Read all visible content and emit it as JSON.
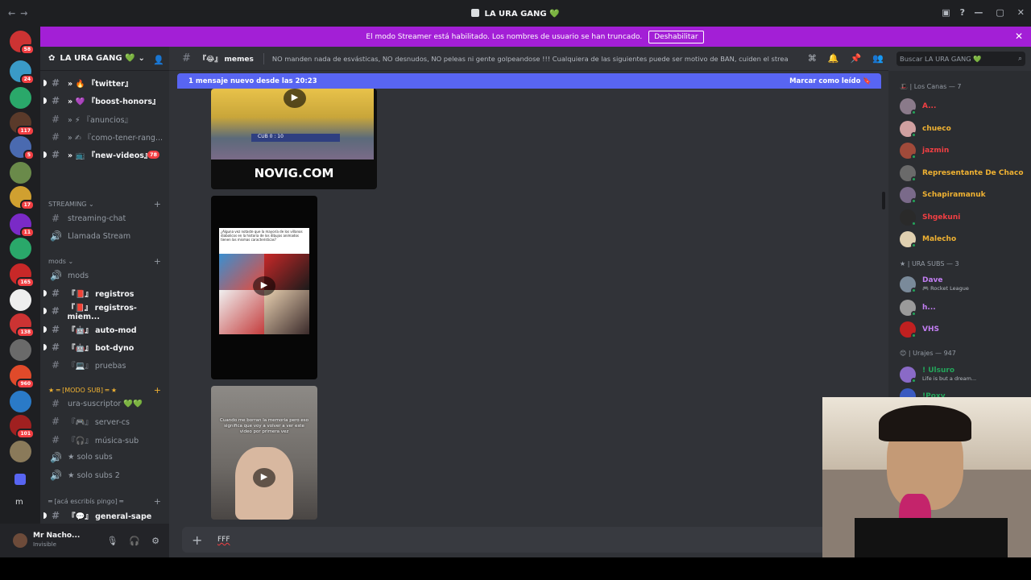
{
  "window": {
    "title": "LA URA GANG 💚"
  },
  "banner": {
    "text": "El modo Streamer está habilitado. Los nombres de usuario se han truncado.",
    "button": "Deshabilitar"
  },
  "servers": [
    {
      "badge": "58"
    },
    {
      "badge": "24"
    },
    {
      "badge": ""
    },
    {
      "badge": "117"
    },
    {
      "badge": "5"
    },
    {
      "badge": ""
    },
    {
      "badge": "17"
    },
    {
      "badge": "11"
    },
    {
      "badge": ""
    },
    {
      "badge": "165"
    },
    {
      "badge": ""
    },
    {
      "badge": "138"
    },
    {
      "badge": ""
    },
    {
      "badge": "960"
    },
    {
      "badge": ""
    },
    {
      "badge": "101"
    },
    {
      "badge": ""
    }
  ],
  "server": {
    "name": "LA URA GANG 💚"
  },
  "channels": [
    {
      "label": "» 🔥 『twitter』",
      "bold": true,
      "y": 0
    },
    {
      "label": "» 💜 『boost-honors』",
      "bold": true
    },
    {
      "label": "» ⚡ 『anuncios』",
      "bold": false
    },
    {
      "label": "» ✍ 『como-tener-rang...",
      "bold": false
    },
    {
      "label": "» 📺 『new-videos』",
      "bold": true,
      "badge": "78"
    }
  ],
  "categories": {
    "streaming": "STREAMING",
    "mods": "mods",
    "modo_sub": "═ [MODO SUB] ═ ★",
    "aca": "═ [acá escribís pingo] ═"
  },
  "streaming_channels": [
    {
      "label": "streaming-chat",
      "icon": "#"
    },
    {
      "label": "Llamada Stream",
      "icon": "🔊"
    }
  ],
  "mods_channels": [
    {
      "label": "mods",
      "icon": "🔊"
    },
    {
      "label": "『📕』 registros",
      "bold": true
    },
    {
      "label": "『📕』 registros-miem...",
      "bold": true
    },
    {
      "label": "『🤖』 auto-mod",
      "bold": true
    },
    {
      "label": "『🤖』 bot-dyno",
      "bold": true
    },
    {
      "label": "『💻』 pruebas",
      "bold": false
    }
  ],
  "sub_channels": [
    {
      "label": "ura-suscriptor 💚💚",
      "icon": "#"
    },
    {
      "label": "『🎮』 server-cs",
      "icon": "#"
    },
    {
      "label": "『🎧』 música-sub",
      "icon": "#"
    },
    {
      "label": "★ solo subs",
      "icon": "🔊"
    },
    {
      "label": "★ solo subs 2",
      "icon": "🔊"
    }
  ],
  "aca_channels": [
    {
      "label": "『💬』 general-sape",
      "bold": true
    },
    {
      "label": "『😂』 memes",
      "active": true
    }
  ],
  "user": {
    "name": "Mr Nacho...",
    "status": "Invisible"
  },
  "chat": {
    "channel": "『😂』 memes",
    "topic": "NO manden nada de esvásticas, NO desnudos, NO peleas ni gente golpeandose !!! Cualquiera de las siguientes puede ser motivo de BAN, cuiden el stream!",
    "new_messages": "1 mensaje nuevo desde las 20:23",
    "mark_read": "Marcar como leído",
    "input": "FFF"
  },
  "media": {
    "m1_text": "NOVIG.COM",
    "m1_score": "CUB 0 : 10",
    "m2_caption": "¿Alguna vez notaste que la mayoría de los villanos diabolicos en la historia de los dibujos animados tienen las mismas características?",
    "m3_caption": "Cuando me borran la memoria pero eso significa que voy a volver a ver este video por primera vez"
  },
  "members": {
    "search": "Buscar LA URA GANG 💚",
    "groups": [
      {
        "title": "🎩 | Los Canas — 7",
        "members": [
          {
            "name": "A...",
            "color": "#f23f43"
          },
          {
            "name": "chueco",
            "color": "#f0b232"
          },
          {
            "name": "jazmin",
            "color": "#f23f43"
          },
          {
            "name": "Representante De Chaco",
            "color": "#f0b232"
          },
          {
            "name": "Schapiramanuk",
            "color": "#f0b232"
          },
          {
            "name": "Shgekuni",
            "color": "#f23f43"
          },
          {
            "name": "Malecho",
            "color": "#f0b232"
          }
        ]
      },
      {
        "title": "★ | URA SUBS — 3",
        "members": [
          {
            "name": "Dave",
            "color": "#c27ef2",
            "sub": "🎮 Rocket League"
          },
          {
            "name": "h...",
            "color": "#c27ef2"
          },
          {
            "name": "VHS",
            "color": "#c27ef2"
          }
        ]
      },
      {
        "title": "😊 | Urajes — 947",
        "members": [
          {
            "name": "! Ulsuro",
            "color": "#23a55a",
            "sub": "Life is but a dream..."
          },
          {
            "name": "!Poxy",
            "color": "#23a55a"
          }
        ]
      }
    ]
  },
  "colors": {
    "accent": "#5865f2",
    "banner": "#a31fd6",
    "bg": "#313338"
  }
}
